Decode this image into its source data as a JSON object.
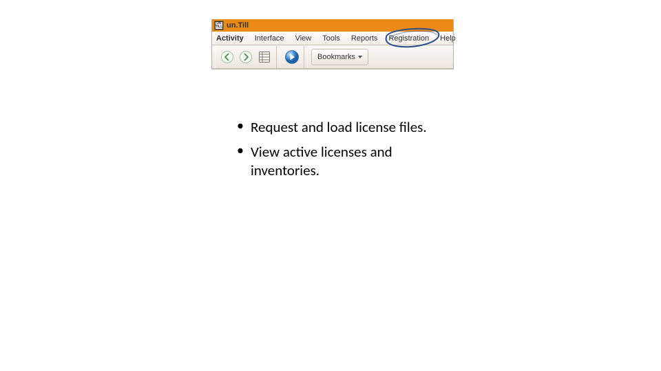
{
  "app": {
    "title": "un.Till",
    "icon_text": "UN\nTILL"
  },
  "menu": {
    "items": [
      {
        "label": "Activity"
      },
      {
        "label": "Interface"
      },
      {
        "label": "View"
      },
      {
        "label": "Tools"
      },
      {
        "label": "Reports"
      },
      {
        "label": "Registration"
      },
      {
        "label": "Help"
      }
    ],
    "highlighted_index": 5
  },
  "toolbar": {
    "bookmarks_label": "Bookmarks"
  },
  "bullets": [
    "Request and load license files.",
    "View active licenses and inventories."
  ]
}
